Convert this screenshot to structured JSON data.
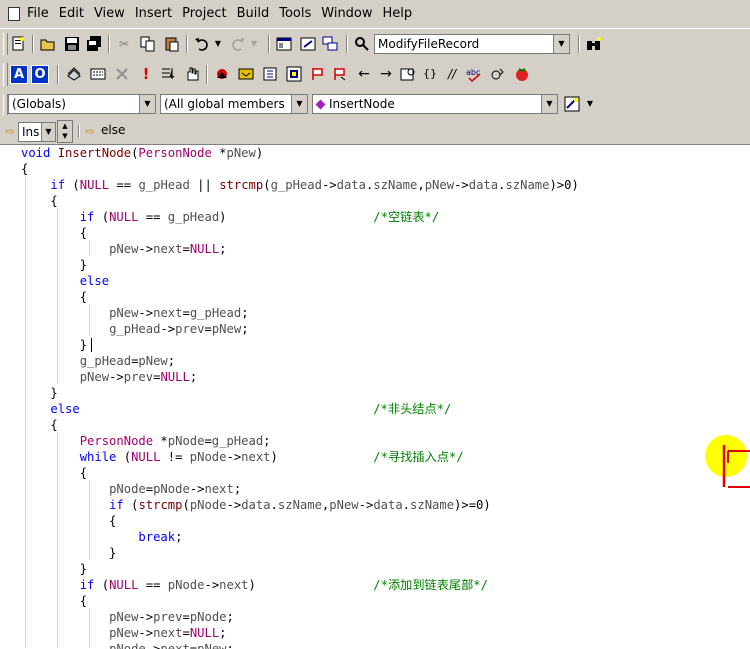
{
  "menu": {
    "items": [
      "File",
      "Edit",
      "View",
      "Insert",
      "Project",
      "Build",
      "Tools",
      "Window",
      "Help"
    ]
  },
  "toolbar1": {
    "icons": [
      "new-file",
      "open-folder",
      "save",
      "save-all",
      "cut",
      "copy",
      "paste",
      "undo",
      "redo",
      "workspace",
      "output",
      "window-list",
      "find-in-files"
    ],
    "find_combo_value": "ModifyFileRecord"
  },
  "toolbar2": {
    "buttons": [
      {
        "label": "A"
      },
      {
        "label": "O"
      }
    ],
    "icons": [
      "compile",
      "build",
      "stop-build",
      "execute",
      "go",
      "insert-breakpoint",
      "set-breakpoint",
      "step-into",
      "step-over",
      "step-out",
      "run-to-cursor",
      "back",
      "forward",
      "watch",
      "variables",
      "registers",
      "memory",
      "call-stack",
      "disassembly"
    ]
  },
  "wizardbar": {
    "class_combo": "(Globals)",
    "filter_combo": "(All global members",
    "member_combo": "InsertNode"
  },
  "toolbar4": {
    "scope_combo": "Ins",
    "context_text": "else"
  },
  "colors": {
    "keyword": "#0000ff",
    "type": "#a0006e",
    "comment": "#008000"
  },
  "code": {
    "lines": [
      "void InsertNode(PersonNode *pNew)",
      "{",
      "    if (NULL == g_pHead || strcmp(g_pHead->data.szName,pNew->data.szName)>0)",
      "    {",
      "        if (NULL == g_pHead)                    /*空链表*/",
      "        {",
      "            pNew->next=NULL;",
      "        }",
      "        else",
      "        {",
      "            pNew->next=g_pHead;",
      "            g_pHead->prev=pNew;",
      "        }",
      "        g_pHead=pNew;",
      "        pNew->prev=NULL;",
      "    }",
      "    else                                        /*非头结点*/",
      "    {",
      "        PersonNode *pNode=g_pHead;",
      "        while (NULL != pNode->next)             /*寻找插入点*/",
      "        {",
      "            pNode=pNode->next;",
      "            if (strcmp(pNode->data.szName,pNew->data.szName)>=0)",
      "            {",
      "                break;",
      "            }",
      "        }",
      "        if (NULL == pNode->next)                /*添加到链表尾部*/",
      "        {",
      "            pNew->prev=pNode;",
      "            pNew->next=NULL;",
      "            pNode->next=pNew;"
    ]
  }
}
